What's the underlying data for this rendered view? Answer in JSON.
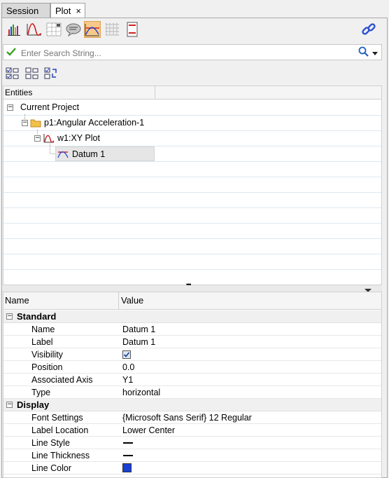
{
  "tabs": [
    {
      "label": "Session",
      "active": false
    },
    {
      "label": "Plot",
      "active": true,
      "close": "×"
    }
  ],
  "toolbar": {
    "icons": [
      "bar-chart-icon",
      "curve-icon",
      "grid-dots-icon",
      "note-icon",
      "datum-icon",
      "grid-icon",
      "page-icon"
    ],
    "active": "datum-icon",
    "link_icon": "link-icon"
  },
  "search": {
    "placeholder": "Enter Search String..."
  },
  "tree": {
    "column": "Entities",
    "items": [
      {
        "label": "Current Project",
        "level": 0
      },
      {
        "label": "p1:Angular Acceleration-1",
        "level": 1
      },
      {
        "label": "w1:XY Plot",
        "level": 2
      },
      {
        "label": "Datum 1",
        "level": 3,
        "selected": true
      }
    ]
  },
  "splitter": {
    "grip": "•••"
  },
  "props": {
    "col_name": "Name",
    "col_value": "Value",
    "sections": [
      {
        "title": "Standard",
        "rows": [
          {
            "name": "Name",
            "value": "Datum 1"
          },
          {
            "name": "Label",
            "value": "Datum 1"
          },
          {
            "name": "Visibility",
            "value": "",
            "checked": true
          },
          {
            "name": "Position",
            "value": "0.0"
          },
          {
            "name": "Associated Axis",
            "value": "Y1"
          },
          {
            "name": "Type",
            "value": "horizontal"
          }
        ]
      },
      {
        "title": "Display",
        "rows": [
          {
            "name": "Font Settings",
            "value": "{Microsoft Sans Serif} 12 Regular"
          },
          {
            "name": "Label Location",
            "value": "Lower Center"
          },
          {
            "name": "Line Style",
            "value": ""
          },
          {
            "name": "Line Thickness",
            "value": ""
          },
          {
            "name": "Line Color",
            "value": "",
            "color": "#1a3fd6"
          }
        ]
      }
    ]
  }
}
